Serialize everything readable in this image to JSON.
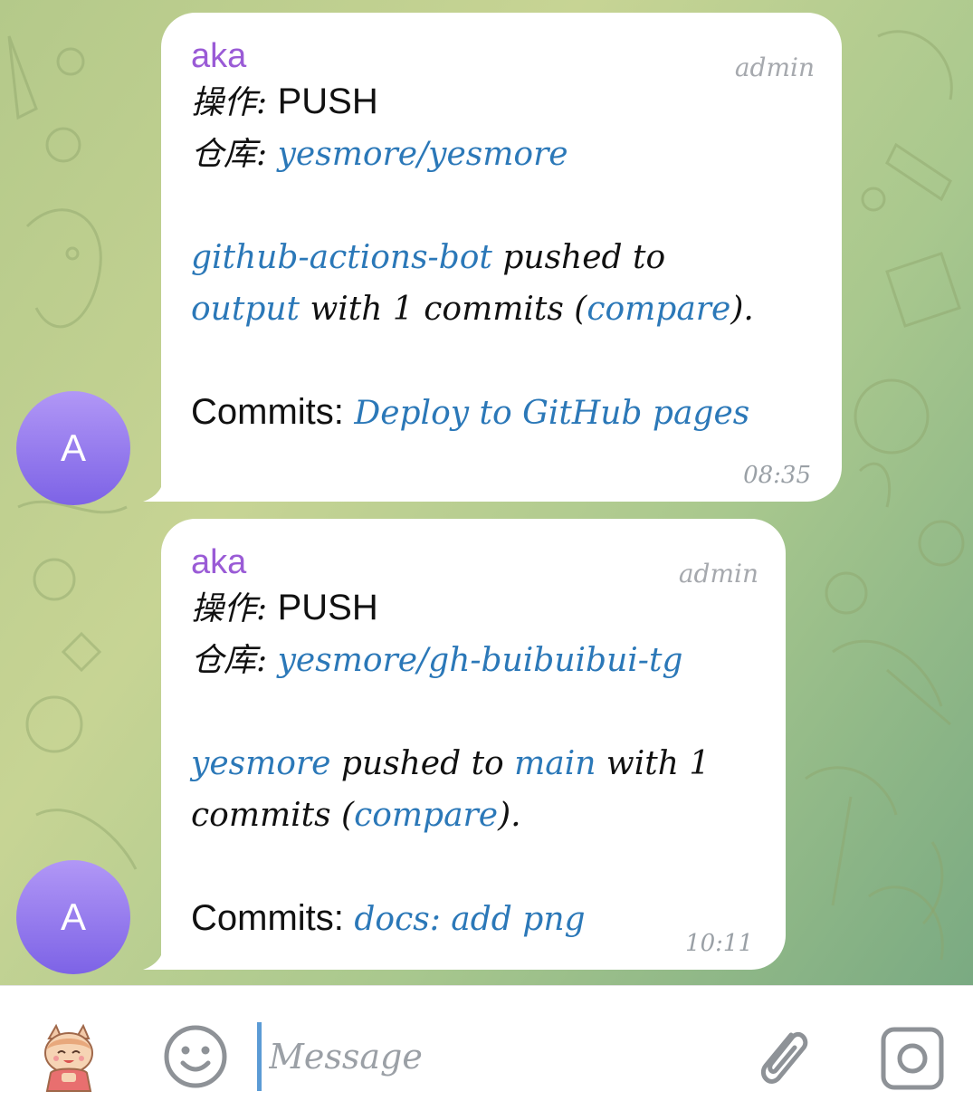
{
  "chat": {
    "messages": [
      {
        "avatar_letter": "A",
        "sender": "aka",
        "role": "admin",
        "op_label": "操作:",
        "op_value": "PUSH",
        "repo_label": "仓库:",
        "repo_value": "yesmore/yesmore",
        "pusher": "github-actions-bot",
        "text1": " pushed to",
        "branch": "output",
        "text2": " with 1 commits (",
        "compare": "compare",
        "text3": ").",
        "commits_label": "Commits:",
        "commit_msg": "Deploy to GitHub pages",
        "time": "08:35"
      },
      {
        "avatar_letter": "A",
        "sender": "aka",
        "role": "admin",
        "op_label": "操作:",
        "op_value": "PUSH",
        "repo_label": "仓库:",
        "repo_value": "yesmore/gh-buibuibui-tg",
        "pusher": "yesmore",
        "text1": " pushed to ",
        "branch": "main",
        "text2": " with 1",
        "text2b": "commits (",
        "compare": "compare",
        "text3": ").",
        "commits_label": "Commits:",
        "commit_msg": "docs: add png",
        "time": "10:11"
      }
    ]
  },
  "composer": {
    "placeholder": "Message",
    "icons": [
      "sticker-icon",
      "emoji-icon",
      "attach-icon",
      "camera-icon"
    ]
  },
  "colors": {
    "sender": "#9a5bd6",
    "link": "#2b78b8",
    "avatar": "#8a6ef0",
    "caret": "#5b9bd5"
  }
}
